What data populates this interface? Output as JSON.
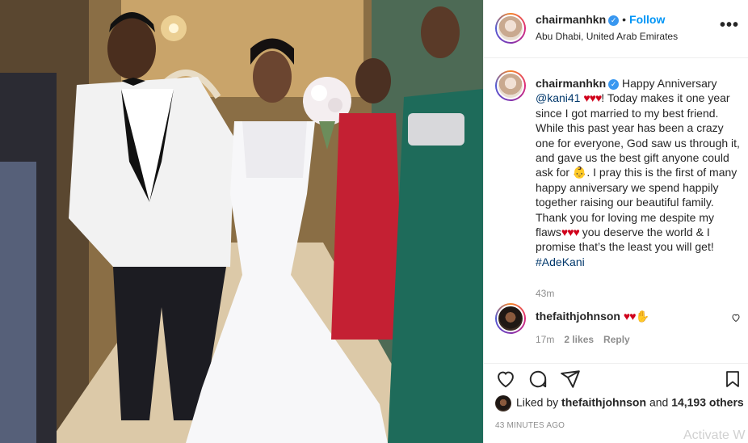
{
  "post": {
    "username": "chairmanhkn",
    "follow_label": "Follow",
    "dot": "•",
    "location": "Abu Dhabi, United Arab Emirates",
    "more_label": "•••",
    "photo_description_icon": "wedding-photo"
  },
  "caption": {
    "username": "chairmanhkn",
    "greeting": "Happy Anniversary",
    "mention": "@kani41",
    "hearts": "♥♥♥",
    "body1": "! Today makes it one year since I got married to my best friend. While this past year has been a crazy one for everyone, God saw us through it, and gave us the best gift anyone could ask for ",
    "baby_emoji": "👶",
    "body2": ". I pray this is the first of many happy anniversary we spend happily together raising our beautiful family. Thank you for loving me despite my flaws",
    "body3": " you deserve the world & I promise that’s the least you will get! ",
    "hashtag": "#AdeKani",
    "time": "43m"
  },
  "comment": {
    "username": "thefaithjohnson",
    "hearts": "♥♥",
    "hand": "✋",
    "time": "17m",
    "likes": "2 likes",
    "reply_label": "Reply"
  },
  "likes_line": {
    "prefix": "Liked by",
    "user": "thefaithjohnson",
    "and": "and",
    "others": "14,193 others"
  },
  "timestamp": "43 MINUTES AGO",
  "watermark": "Activate W",
  "colors": {
    "link": "#00376b",
    "follow": "#0095f6",
    "heart": "#d0021b",
    "muted": "#8e8e8e",
    "verified": "#3897f0"
  }
}
